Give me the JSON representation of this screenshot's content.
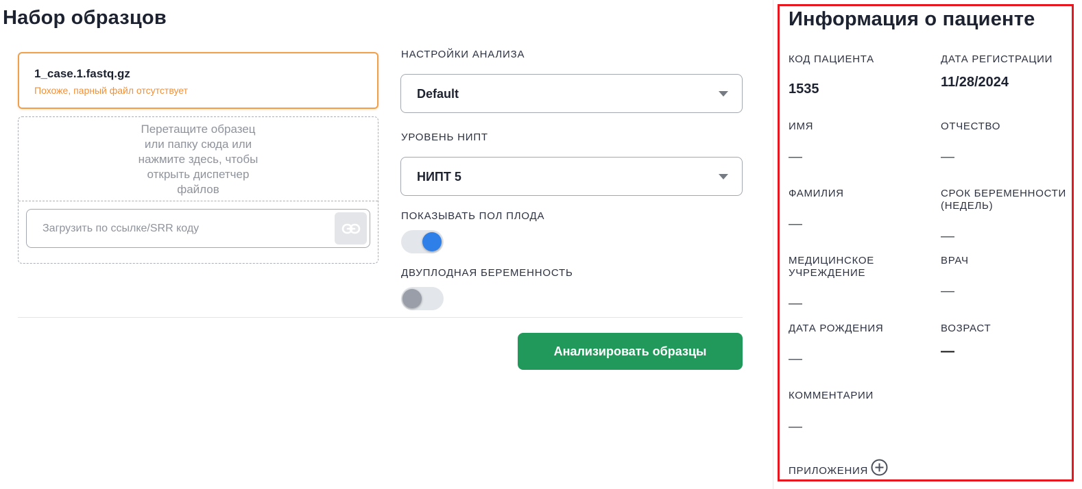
{
  "page": {
    "title": "Набор образцов"
  },
  "file": {
    "name": "1_case.1.fastq.gz",
    "warning": "Похоже, парный файл отсутствует"
  },
  "dropzone": {
    "lines": [
      "Перетащите образец",
      "или папку сюда или",
      "нажмите здесь, чтобы",
      "открыть диспетчер",
      "файлов"
    ],
    "url_placeholder": "Загрузить по ссылке/SRR коду",
    "link_icon": "link-icon"
  },
  "settings": {
    "analysis_label": "НАСТРОЙКИ АНАЛИЗА",
    "analysis_value": "Default",
    "nipt_label": "УРОВЕНЬ НИПТ",
    "nipt_value": "НИПТ 5",
    "fetal_sex_label": "ПОКАЗЫВАТЬ ПОЛ ПЛОДА",
    "fetal_sex_on": true,
    "twin_label": "ДВУПЛОДНАЯ БЕРЕМЕННОСТЬ",
    "twin_on": false,
    "analyze_label": "Анализировать образцы"
  },
  "patient": {
    "title": "Информация о пациенте",
    "code_label": "КОД ПАЦИЕНТА",
    "code_value": "1535",
    "reg_date_label": "ДАТА РЕГИСТРАЦИИ",
    "reg_date_value": "11/28/2024",
    "first_name_label": "ИМЯ",
    "first_name_value": "—",
    "patronymic_label": "ОТЧЕСТВО",
    "patronymic_value": "—",
    "last_name_label": "ФАМИЛИЯ",
    "last_name_value": "—",
    "gest_age_label_1": "СРОК БЕРЕМЕННОСТИ",
    "gest_age_label_2": "(НЕДЕЛЬ)",
    "gest_age_value": "—",
    "institution_label_1": "МЕДИЦИНСКОЕ",
    "institution_label_2": "УЧРЕЖДЕНИЕ",
    "institution_value": "—",
    "doctor_label": "ВРАЧ",
    "doctor_value": "—",
    "birth_date_label": "ДАТА РОЖДЕНИЯ",
    "birth_date_value": "—",
    "age_label": "ВОЗРАСТ",
    "age_value": "—",
    "comments_label": "КОММЕНТАРИИ",
    "comments_value": "—",
    "attachments_label": "ПРИЛОЖЕНИЯ",
    "attachments_icon": "plus-circle-icon"
  },
  "colors": {
    "accent_orange": "#f0a04b",
    "primary_blue": "#2f7fe8",
    "success_green": "#21995a",
    "highlight_red": "#e8171f"
  }
}
